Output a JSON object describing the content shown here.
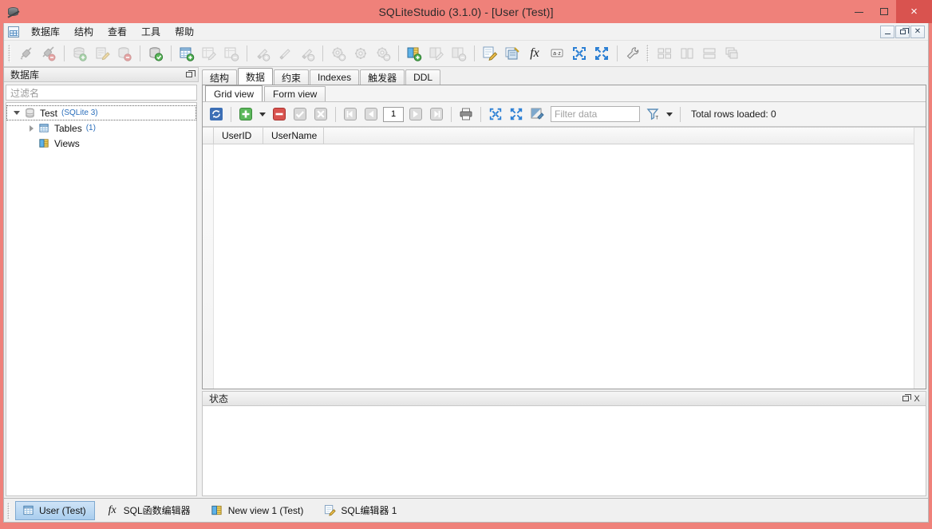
{
  "window": {
    "title": "SQLiteStudio (3.1.0) - [User (Test)]",
    "app_icon": "database-barrel-icon",
    "accent_frame_color": "#ef817a",
    "close_button_color": "#d9534f",
    "minimize_label": "–",
    "maximize_label": "□",
    "close_label": "×"
  },
  "menubar": {
    "items": [
      {
        "label": "数据库",
        "name": "menu-database"
      },
      {
        "label": "结构",
        "name": "menu-structure"
      },
      {
        "label": "查看",
        "name": "menu-view"
      },
      {
        "label": "工具",
        "name": "menu-tools"
      },
      {
        "label": "帮助",
        "name": "menu-help"
      }
    ],
    "mdi_minimize": "–",
    "mdi_restore": "❐",
    "mdi_close": "✕"
  },
  "toolbar": {
    "groups": [
      {
        "name": "connection-group",
        "buttons": [
          {
            "name": "connect-to-database-icon",
            "glyph": "plug"
          },
          {
            "name": "disconnect-from-database-icon",
            "glyph": "plug-off"
          }
        ]
      },
      {
        "name": "database-group",
        "buttons": [
          {
            "name": "add-database-icon",
            "glyph": "db-add"
          },
          {
            "name": "edit-database-icon",
            "glyph": "db-edit"
          },
          {
            "name": "remove-database-icon",
            "glyph": "db-remove"
          },
          {
            "name": "connect-database-icon",
            "glyph": "db-connect"
          }
        ]
      },
      {
        "name": "table-group",
        "buttons": [
          {
            "name": "create-table-icon",
            "glyph": "table-add"
          },
          {
            "name": "edit-table-icon",
            "glyph": "table-edit"
          },
          {
            "name": "delete-table-icon",
            "glyph": "table-remove"
          }
        ]
      },
      {
        "name": "index-group",
        "buttons": [
          {
            "name": "create-index-icon",
            "glyph": "index-add"
          },
          {
            "name": "edit-index-icon",
            "glyph": "index-edit"
          },
          {
            "name": "delete-index-icon",
            "glyph": "index-remove"
          }
        ]
      },
      {
        "name": "trigger-group",
        "buttons": [
          {
            "name": "create-trigger-icon",
            "glyph": "gear-add"
          },
          {
            "name": "edit-trigger-icon",
            "glyph": "gear-edit"
          },
          {
            "name": "delete-trigger-icon",
            "glyph": "gear-remove"
          }
        ]
      },
      {
        "name": "view-group",
        "buttons": [
          {
            "name": "create-view-icon",
            "glyph": "view-add"
          },
          {
            "name": "edit-view-icon",
            "glyph": "view-edit"
          },
          {
            "name": "delete-view-icon",
            "glyph": "view-remove"
          }
        ]
      },
      {
        "name": "editor-group",
        "buttons": [
          {
            "name": "open-sql-editor-icon",
            "glyph": "sql-editor"
          },
          {
            "name": "open-sql-functions-editor-icon",
            "glyph": "functions-editor"
          },
          {
            "name": "custom-sql-function-icon",
            "glyph": "fx"
          },
          {
            "name": "collation-editor-icon",
            "glyph": "az"
          },
          {
            "name": "import-icon",
            "glyph": "import-arrows"
          },
          {
            "name": "export-icon",
            "glyph": "export-arrows"
          }
        ]
      },
      {
        "name": "settings-group",
        "buttons": [
          {
            "name": "open-configuration-icon",
            "glyph": "wrench"
          }
        ]
      },
      {
        "name": "window-layout-group",
        "buttons": [
          {
            "name": "tile-windows-icon",
            "glyph": "tile"
          },
          {
            "name": "tile-vertical-icon",
            "glyph": "tile-v"
          },
          {
            "name": "tile-horizontal-icon",
            "glyph": "tile-h"
          },
          {
            "name": "cascade-windows-icon",
            "glyph": "cascade"
          }
        ]
      }
    ]
  },
  "sidebar": {
    "title": "数据库",
    "float_button": "undock",
    "filter_placeholder": "过滤名",
    "tree": [
      {
        "name": "tree-node-database",
        "label": "Test",
        "meta": "(SQLite 3)",
        "icon": "database-icon",
        "expanded": true,
        "selected": true,
        "children": [
          {
            "name": "tree-node-tables",
            "label": "Tables",
            "meta": "(1)",
            "icon": "tables-icon",
            "expanded": false,
            "selected": false
          },
          {
            "name": "tree-node-views",
            "label": "Views",
            "meta": "",
            "icon": "views-icon",
            "expanded": null,
            "selected": false
          }
        ]
      }
    ]
  },
  "editor": {
    "tabs": [
      {
        "label": "结构",
        "name": "tab-structure",
        "active": false
      },
      {
        "label": "数据",
        "name": "tab-data",
        "active": true
      },
      {
        "label": "约束",
        "name": "tab-constraints",
        "active": false
      },
      {
        "label": "Indexes",
        "name": "tab-indexes",
        "active": false
      },
      {
        "label": "触发器",
        "name": "tab-triggers",
        "active": false
      },
      {
        "label": "DDL",
        "name": "tab-ddl",
        "active": false
      }
    ],
    "subtabs": [
      {
        "label": "Grid view",
        "name": "subtab-grid-view",
        "active": true
      },
      {
        "label": "Form view",
        "name": "subtab-form-view",
        "active": false
      }
    ],
    "data_toolbar": {
      "refresh": "refresh-icon",
      "insert_row": "insert-row-icon",
      "insert_row_dropdown": "insert-row-dropdown-arrow-icon",
      "delete_row": "delete-row-icon",
      "commit": "commit-icon",
      "rollback": "rollback-icon",
      "first_page": "first-page-icon",
      "previous_page": "previous-page-icon",
      "page_number": "1",
      "next_page": "next-page-icon",
      "last_page": "last-page-icon",
      "print": "print-icon",
      "grid_collapse": "grid-collapse-icon",
      "grid_expand": "grid-expand-icon",
      "sort_toggle": "sort-toggle-icon",
      "filter_placeholder": "Filter data",
      "filter_mode_icon": "filter-funnel-icon",
      "filter_mode_dropdown": "filter-dropdown-arrow-icon",
      "total_rows_label": "Total rows loaded: 0"
    },
    "grid": {
      "columns": [
        "UserID",
        "UserName"
      ],
      "rows": []
    }
  },
  "status_panel": {
    "title": "状态",
    "float_button": "undock",
    "close_button": "X",
    "content": ""
  },
  "taskbar": {
    "items": [
      {
        "label": "User (Test)",
        "name": "taskbar-item-user-test",
        "icon": "table-icon",
        "active": true
      },
      {
        "label": "SQL函数编辑器",
        "name": "taskbar-item-sql-functions-editor",
        "icon": "fx-icon",
        "active": false
      },
      {
        "label": "New view 1 (Test)",
        "name": "taskbar-item-new-view-1",
        "icon": "view-icon",
        "active": false
      },
      {
        "label": "SQL编辑器 1",
        "name": "taskbar-item-sql-editor-1",
        "icon": "sql-editor-icon",
        "active": false
      }
    ]
  }
}
